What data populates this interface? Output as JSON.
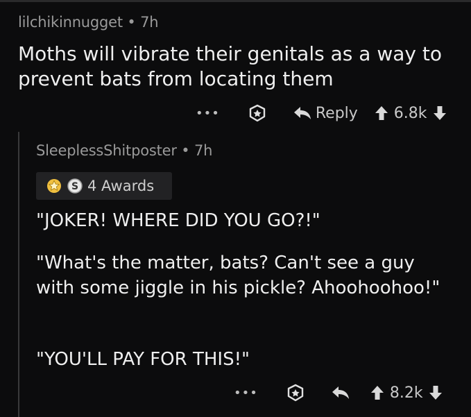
{
  "comment1": {
    "username": "lilchikinnugget",
    "separator": "•",
    "time": "7h",
    "body": "Moths will vibrate their genitals as a way to prevent bats from locating them",
    "actions": {
      "more": "•••",
      "award_icon": "award-icon",
      "reply_icon": "reply-arrow-icon",
      "reply_label": "Reply",
      "score": "6.8k"
    }
  },
  "comment2": {
    "username": "SleeplessShitposter",
    "separator": "•",
    "time": "7h",
    "awards_label": "4 Awards",
    "paragraphs": [
      "\"JOKER! WHERE DID YOU GO?!\"",
      "\"What's the matter, bats? Can't see a guy with some jiggle in his pickle? Ahoohoohoo!\"",
      "\"YOU'LL PAY FOR THIS!\""
    ],
    "actions": {
      "more": "•••",
      "award_icon": "award-icon",
      "reply_icon": "reply-arrow-icon",
      "score": "8.2k"
    }
  },
  "colors": {
    "background": "#0c0c0d",
    "text": "#efefef",
    "meta": "#9a9a9a",
    "award_badge": "#222224"
  }
}
